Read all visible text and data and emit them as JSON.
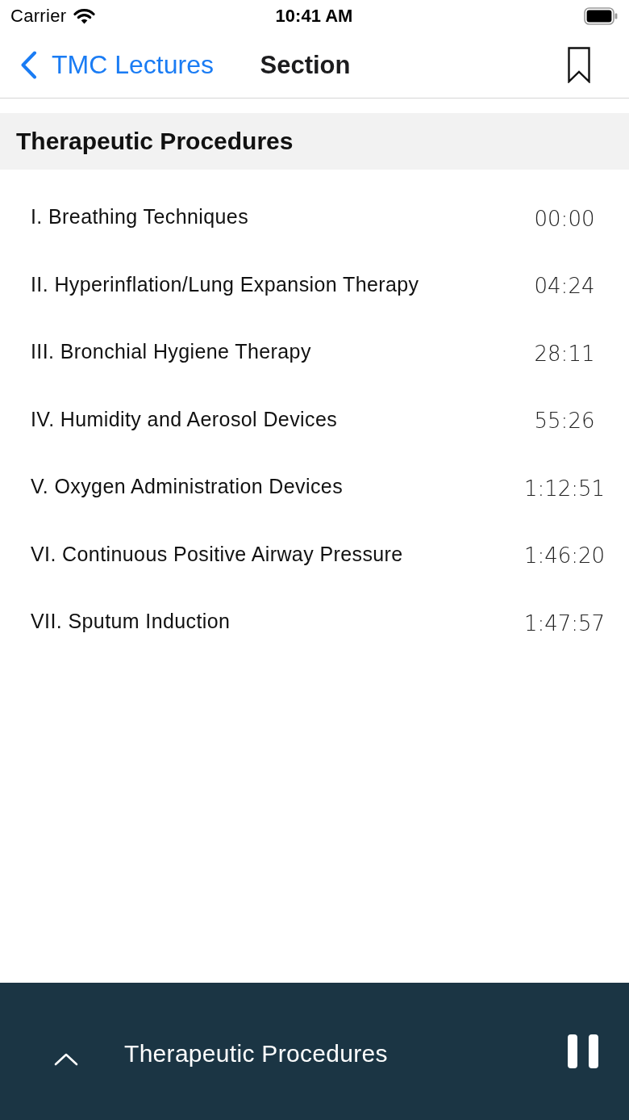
{
  "status_bar": {
    "carrier": "Carrier",
    "time": "10:41 AM"
  },
  "nav_bar": {
    "back_label": "TMC Lectures",
    "title": "Section",
    "bookmarked": false
  },
  "section": {
    "title": "Therapeutic Procedures",
    "items": [
      {
        "title": "I. Breathing Techniques",
        "time": "00:00"
      },
      {
        "title": "II. Hyperinflation/Lung Expansion Therapy",
        "time": "04:24"
      },
      {
        "title": "III. Bronchial Hygiene Therapy",
        "time": "28:11"
      },
      {
        "title": "IV. Humidity and Aerosol Devices",
        "time": "55:26"
      },
      {
        "title": "V. Oxygen Administration Devices",
        "time": "1:12:51"
      },
      {
        "title": "VI. Continuous Positive Airway Pressure",
        "time": "1:46:20"
      },
      {
        "title": "VII. Sputum Induction",
        "time": "1:47:57"
      }
    ]
  },
  "player": {
    "title": "Therapeutic Procedures",
    "playing": true
  }
}
